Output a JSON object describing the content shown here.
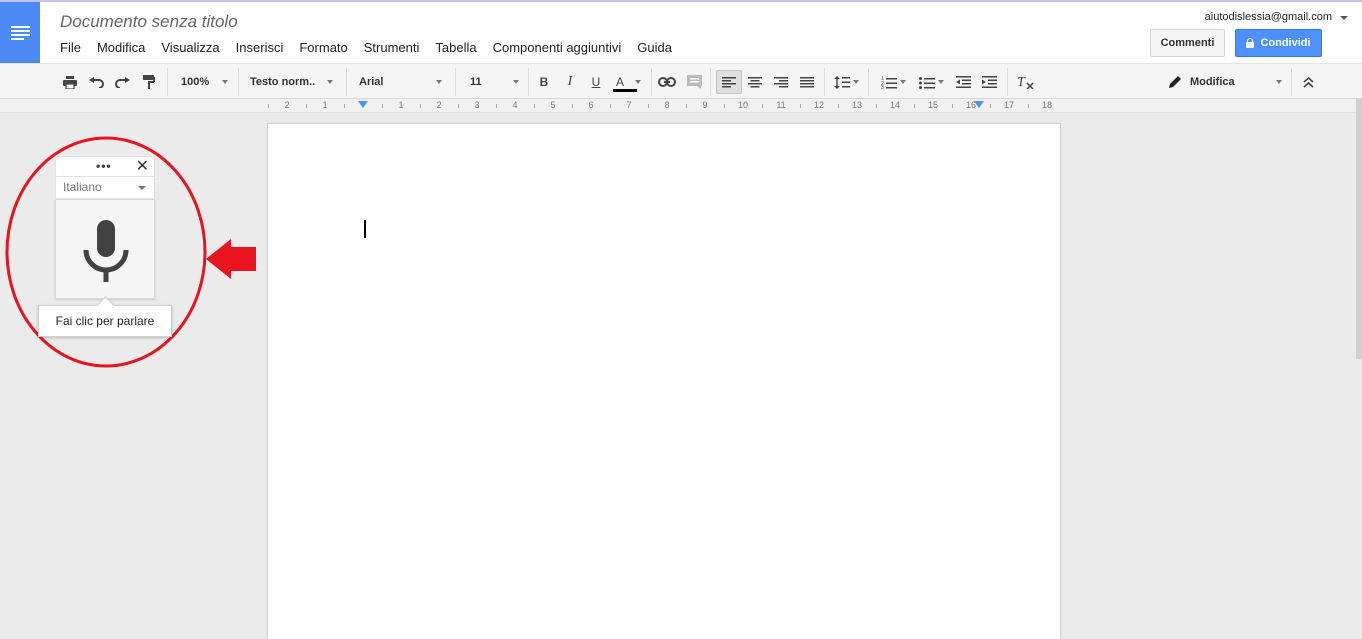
{
  "header": {
    "doc_title": "Documento senza titolo",
    "menu": [
      "File",
      "Modifica",
      "Visualizza",
      "Inserisci",
      "Formato",
      "Strumenti",
      "Tabella",
      "Componenti aggiuntivi",
      "Guida"
    ],
    "account": "aiutodislessia@gmail.com",
    "comments_label": "Commenti",
    "share_label": "Condividi",
    "share_color": "#4d90fe"
  },
  "toolbar": {
    "zoom": "100%",
    "style": "Testo norm..",
    "font": "Arial",
    "size": "11",
    "mode": "Modifica",
    "icons": [
      "print-icon",
      "undo-icon",
      "redo-icon",
      "paint-format-icon",
      "bold-icon",
      "italic-icon",
      "underline-icon",
      "text-color-icon",
      "link-icon",
      "comment-icon",
      "align-left-icon",
      "align-center-icon",
      "align-right-icon",
      "justify-icon",
      "line-spacing-icon",
      "numbered-list-icon",
      "bulleted-list-icon",
      "decrease-indent-icon",
      "increase-indent-icon",
      "clear-formatting-icon",
      "pencil-icon",
      "collapse-icon"
    ]
  },
  "ruler": {
    "numbers": [
      "2",
      "1",
      "1",
      "2",
      "3",
      "4",
      "5",
      "6",
      "7",
      "8",
      "9",
      "10",
      "11",
      "12",
      "13",
      "14",
      "15",
      "16",
      "17",
      "18"
    ]
  },
  "voice_typing": {
    "language": "Italiano",
    "tooltip": "Fai clic per parlare",
    "menu_dots": "•••",
    "close": "✕"
  },
  "annotation": {
    "color": "#e8141e"
  }
}
